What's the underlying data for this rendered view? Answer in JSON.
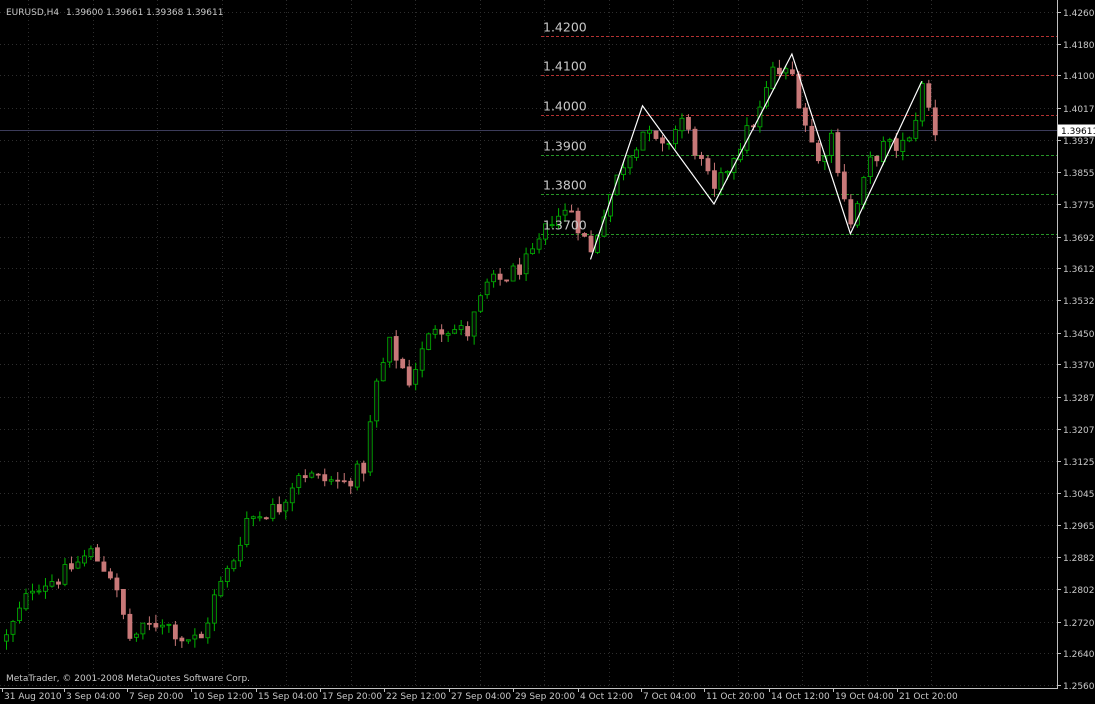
{
  "header": {
    "symbol": "EURUSD,H4",
    "ohlc": "1.39600 1.39661 1.39368 1.39611"
  },
  "watermark": "MetaTrader, © 2001-2008 MetaQuotes Software Corp.",
  "colors": {
    "background": "#000000",
    "grid": "#2e2e2e",
    "axis": "#c0c0c0",
    "text": "#c8c8c8",
    "bull_body": "#0a0a0a",
    "bull_border": "#00b400",
    "bear_body": "#c87878",
    "bear_border": "#c87878",
    "wick_bull": "#00b400",
    "wick_bear": "#c87878",
    "resistance_line": "#b43232",
    "support_line": "#289628",
    "zigzag": "#ffffff",
    "current_price_line": "#3c3c5a",
    "price_tag_bg": "#ffffff",
    "price_tag_text": "#000000"
  },
  "chart_data": {
    "type": "candlestick",
    "title": "EURUSD,H4",
    "ylim": [
      1.256,
      1.426
    ],
    "y_tick_labels": [
      "1.42600",
      "1.41800",
      "1.41000",
      "1.40175",
      "1.39375",
      "1.38550",
      "1.37750",
      "1.36925",
      "1.36125",
      "1.35325",
      "1.34500",
      "1.33700",
      "1.32875",
      "1.32075",
      "1.31250",
      "1.30450",
      "1.29650",
      "1.28825",
      "1.28025",
      "1.27200",
      "1.26400",
      "1.25600"
    ],
    "x_tick_labels": [
      "31 Aug 2010",
      "3 Sep 04:00",
      "7 Sep 20:00",
      "10 Sep 12:00",
      "15 Sep 04:00",
      "17 Sep 20:00",
      "22 Sep 12:00",
      "27 Sep 04:00",
      "29 Sep 20:00",
      "4 Oct 12:00",
      "7 Oct 04:00",
      "11 Oct 20:00",
      "14 Oct 12:00",
      "19 Oct 04:00",
      "21 Oct 20:00"
    ],
    "n_bars": 144,
    "current_price": "1.39611",
    "horizontal_levels": [
      {
        "label": "1.4200",
        "value": 1.42,
        "kind": "resistance"
      },
      {
        "label": "1.4100",
        "value": 1.41,
        "kind": "resistance"
      },
      {
        "label": "1.4000",
        "value": 1.4,
        "kind": "resistance"
      },
      {
        "label": "1.3900",
        "value": 1.39,
        "kind": "support"
      },
      {
        "label": "1.3800",
        "value": 1.38,
        "kind": "support"
      },
      {
        "label": "1.3700",
        "value": 1.37,
        "kind": "support"
      }
    ],
    "zigzag_points": [
      [
        90,
        1.3635
      ],
      [
        98,
        1.4023
      ],
      [
        109,
        1.3775
      ],
      [
        121,
        1.4154
      ],
      [
        130,
        1.37
      ],
      [
        141,
        1.4085
      ]
    ],
    "price_path": [
      [
        0,
        1.268
      ],
      [
        4,
        1.281
      ],
      [
        8,
        1.283
      ],
      [
        13,
        1.2895
      ],
      [
        16,
        1.284
      ],
      [
        19,
        1.268
      ],
      [
        24,
        1.2725
      ],
      [
        27,
        1.268
      ],
      [
        30,
        1.2675
      ],
      [
        32,
        1.278
      ],
      [
        35,
        1.288
      ],
      [
        37,
        1.298
      ],
      [
        42,
        1.301
      ],
      [
        45,
        1.31
      ],
      [
        48,
        1.308
      ],
      [
        52,
        1.307
      ],
      [
        55,
        1.311
      ],
      [
        57,
        1.332
      ],
      [
        59,
        1.342
      ],
      [
        62,
        1.333
      ],
      [
        66,
        1.347
      ],
      [
        71,
        1.345
      ],
      [
        74,
        1.357
      ],
      [
        77,
        1.359
      ],
      [
        81,
        1.364
      ],
      [
        84,
        1.374
      ],
      [
        87,
        1.376
      ],
      [
        90,
        1.365
      ],
      [
        92,
        1.376
      ],
      [
        95,
        1.388
      ],
      [
        98,
        1.396
      ],
      [
        101,
        1.391
      ],
      [
        104,
        1.399
      ],
      [
        109,
        1.38
      ],
      [
        112,
        1.39
      ],
      [
        116,
        1.401
      ],
      [
        118,
        1.411
      ],
      [
        121,
        1.41
      ],
      [
        123,
        1.398
      ],
      [
        125,
        1.388
      ],
      [
        127,
        1.395
      ],
      [
        130,
        1.372
      ],
      [
        133,
        1.388
      ],
      [
        135,
        1.392
      ],
      [
        137,
        1.392
      ],
      [
        139,
        1.393
      ],
      [
        141,
        1.407
      ],
      [
        143,
        1.396
      ]
    ]
  }
}
